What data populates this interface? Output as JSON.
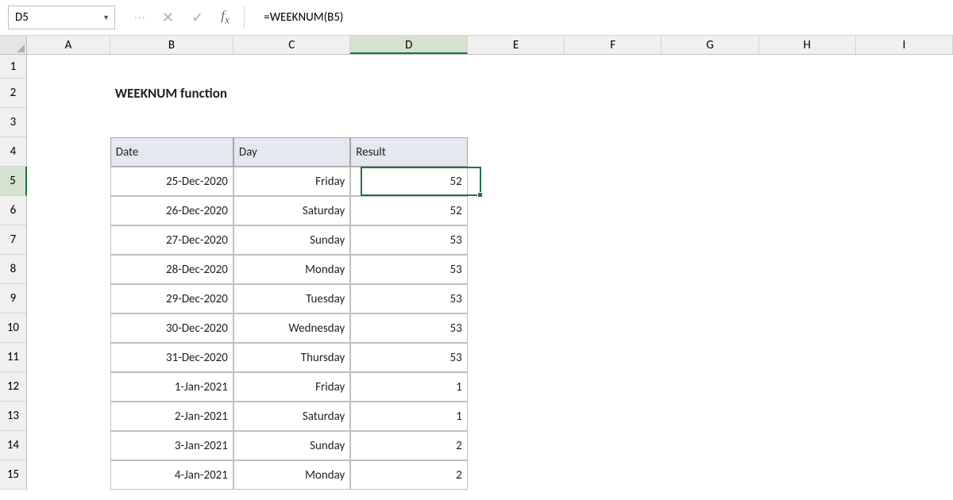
{
  "nameBox": "D5",
  "formula": "=WEEKNUM(B5)",
  "columns": [
    "A",
    "B",
    "C",
    "D",
    "E",
    "F",
    "G",
    "H",
    "I"
  ],
  "activeColumn": "D",
  "activeRow": 5,
  "title": "WEEKNUM function",
  "headers": {
    "date": "Date",
    "day": "Day",
    "result": "Result"
  },
  "rows": [
    {
      "date": "25-Dec-2020",
      "day": "Friday",
      "result": "52"
    },
    {
      "date": "26-Dec-2020",
      "day": "Saturday",
      "result": "52"
    },
    {
      "date": "27-Dec-2020",
      "day": "Sunday",
      "result": "53"
    },
    {
      "date": "28-Dec-2020",
      "day": "Monday",
      "result": "53"
    },
    {
      "date": "29-Dec-2020",
      "day": "Tuesday",
      "result": "53"
    },
    {
      "date": "30-Dec-2020",
      "day": "Wednesday",
      "result": "53"
    },
    {
      "date": "31-Dec-2020",
      "day": "Thursday",
      "result": "53"
    },
    {
      "date": "1-Jan-2021",
      "day": "Friday",
      "result": "1"
    },
    {
      "date": "2-Jan-2021",
      "day": "Saturday",
      "result": "1"
    },
    {
      "date": "3-Jan-2021",
      "day": "Sunday",
      "result": "2"
    },
    {
      "date": "4-Jan-2021",
      "day": "Monday",
      "result": "2"
    }
  ],
  "chart_data": {
    "type": "table",
    "title": "WEEKNUM function",
    "columns": [
      "Date",
      "Day",
      "Result"
    ],
    "data": [
      [
        "25-Dec-2020",
        "Friday",
        52
      ],
      [
        "26-Dec-2020",
        "Saturday",
        52
      ],
      [
        "27-Dec-2020",
        "Sunday",
        53
      ],
      [
        "28-Dec-2020",
        "Monday",
        53
      ],
      [
        "29-Dec-2020",
        "Tuesday",
        53
      ],
      [
        "30-Dec-2020",
        "Wednesday",
        53
      ],
      [
        "31-Dec-2020",
        "Thursday",
        53
      ],
      [
        "1-Jan-2021",
        "Friday",
        1
      ],
      [
        "2-Jan-2021",
        "Saturday",
        1
      ],
      [
        "3-Jan-2021",
        "Sunday",
        2
      ],
      [
        "4-Jan-2021",
        "Monday",
        2
      ]
    ]
  }
}
